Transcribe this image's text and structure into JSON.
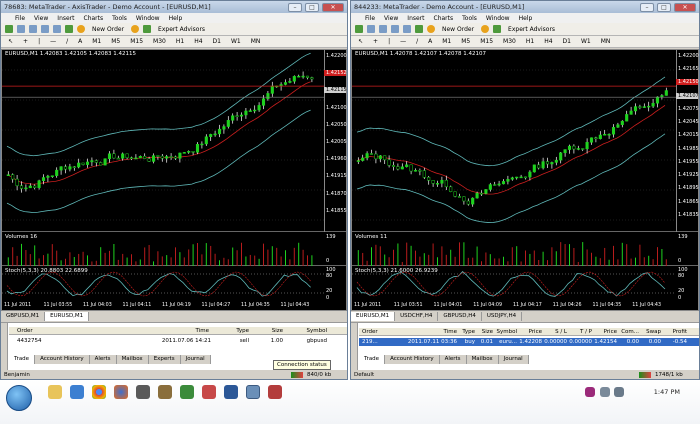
{
  "left": {
    "title": "78683: MetaTrader - AxisTrader - Demo Account - [EURUSD,M1]",
    "menu": [
      "File",
      "View",
      "Insert",
      "Charts",
      "Tools",
      "Window",
      "Help"
    ],
    "toolbar": {
      "new_order": "New Order",
      "expert_advisors": "Expert Advisors",
      "periods": [
        "M1",
        "M5",
        "M15",
        "M30",
        "H1",
        "H4",
        "D1",
        "W1",
        "MN"
      ]
    },
    "chart": {
      "header": "EURUSD,M1  1.42083 1.42105 1.42083 1.42115",
      "prices": [
        "1.42200",
        "1.42152",
        "1.42115",
        "1.42100",
        "1.42050",
        "1.42005",
        "1.41960",
        "1.41915",
        "1.41870",
        "1.41855"
      ],
      "highlight_red": "1.42152",
      "highlight_gray": "1.42115",
      "volumes_label": "Volumes 16",
      "vol_scale": [
        "139",
        "0"
      ],
      "stoch_label": "Stoch(5,3,3) 20.8803 22.6899",
      "stoch_scale": [
        "100",
        "80",
        "20",
        "0"
      ],
      "times": [
        "11 Jul 2011",
        "11 Jul 03:55",
        "11 Jul 04:03",
        "11 Jul 04:11",
        "11 Jul 04:19",
        "11 Jul 04:27",
        "11 Jul 04:35",
        "11 Jul 04:43"
      ]
    },
    "chart_tabs": [
      "GBPUSD,M1",
      "EURUSD,M1"
    ],
    "terminal": {
      "side_label": "Terminal",
      "headers": [
        "Order",
        "Time",
        "Type",
        "Size",
        "Symbol"
      ],
      "row": {
        "order": "4432754",
        "time": "2011.07.06 14:21",
        "type": "sell",
        "size": "1.00",
        "symbol": "gbpusd"
      },
      "tabs": [
        "Trade",
        "Account History",
        "Alerts",
        "Mailbox",
        "Experts",
        "Journal"
      ],
      "tooltip": "Connection status"
    },
    "status": {
      "name": "Benjamin",
      "traffic": "840/0 kb"
    }
  },
  "right": {
    "title": "844233: MetaTrader - Demo Account - [EURUSD,M1]",
    "menu": [
      "File",
      "View",
      "Insert",
      "Charts",
      "Tools",
      "Window",
      "Help"
    ],
    "toolbar": {
      "new_order": "New Order",
      "expert_advisors": "Expert Advisors",
      "periods": [
        "M1",
        "M5",
        "M15",
        "M30",
        "H1",
        "H4",
        "D1",
        "W1",
        "MN"
      ]
    },
    "chart": {
      "header": "EURUSD,M1  1.42078 1.42107 1.42078 1.42107",
      "prices": [
        "1.42200",
        "1.42165",
        "1.42150",
        "1.42107",
        "1.42075",
        "1.42045",
        "1.42015",
        "1.41985",
        "1.41955",
        "1.41925",
        "1.41895",
        "1.41865",
        "1.41835"
      ],
      "highlight_red": "1.42150",
      "highlight_gray": "1.42107",
      "volumes_label": "Volumes 11",
      "vol_scale": [
        "139",
        "0"
      ],
      "stoch_label": "Stoch(5,3,3) 21.6000 26.9239",
      "stoch_scale": [
        "100",
        "80",
        "20",
        "0"
      ],
      "times": [
        "11 Jul 2011",
        "11 Jul 03:51",
        "11 Jul 04:01",
        "11 Jul 04:09",
        "11 Jul 04:17",
        "11 Jul 04:26",
        "11 Jul 04:35",
        "11 Jul 04:43"
      ]
    },
    "chart_tabs": [
      "EURUSD,M1",
      "USDCHF,H4",
      "GBPUSD,H4",
      "USDJPY,H4"
    ],
    "terminal": {
      "side_label": "Terminal",
      "headers": [
        "Order",
        "Time",
        "Type",
        "Size",
        "Symbol",
        "Price",
        "S / L",
        "T / P",
        "Price",
        "Com...",
        "Swap",
        "Profit"
      ],
      "row": {
        "order": "219...",
        "time": "2011.07.11 03:36",
        "type": "buy",
        "size": "0.01",
        "symbol": "euru...",
        "price": "1.42208",
        "sl": "0.00000",
        "tp": "0.00000",
        "cur": "1.42154",
        "com": "0.00",
        "swap": "0.00",
        "profit": "-0.54"
      },
      "tabs": [
        "Trade",
        "Account History",
        "Alerts",
        "Mailbox",
        "Journal"
      ]
    },
    "status": {
      "name": "Default",
      "traffic": "1748/1 kb"
    }
  },
  "taskbar": {
    "clock": "1:47 PM"
  }
}
